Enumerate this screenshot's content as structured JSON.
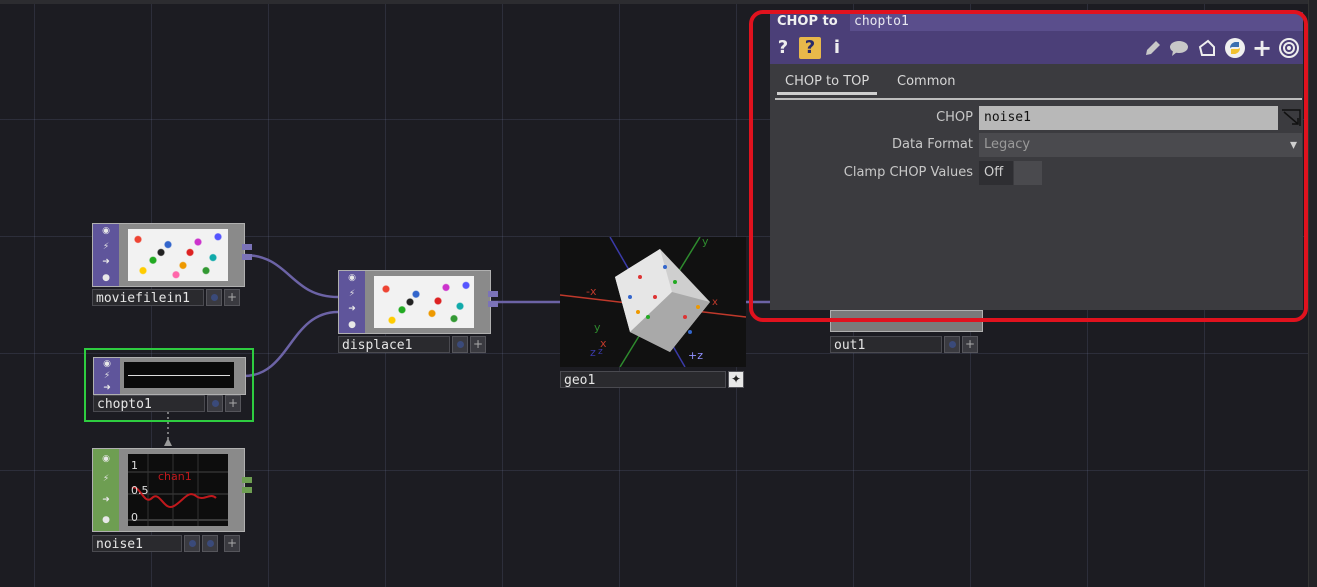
{
  "network": {
    "nodes": {
      "moviefilein1": {
        "name": "moviefilein1"
      },
      "displace1": {
        "name": "displace1"
      },
      "chopto1": {
        "name": "chopto1"
      },
      "noise1": {
        "name": "noise1",
        "graph_labels": [
          "1",
          "0.5",
          "0"
        ],
        "channel": "chan1"
      },
      "geo1": {
        "name": "geo1",
        "axis_labels": [
          "-x",
          "x",
          "y",
          "y",
          "z",
          "z",
          "+z",
          "x"
        ]
      },
      "out1": {
        "name": "out1"
      }
    }
  },
  "panel": {
    "op_type": "CHOP to",
    "op_name": "chopto1",
    "toolbar_icons": [
      "help-icon",
      "operator-help-icon",
      "info-icon",
      "edit-icon",
      "comment-icon",
      "clone-icon",
      "python-icon",
      "add-icon",
      "settings-icon"
    ],
    "toolbar_glyphs": {
      "help": "?",
      "op_help": "?",
      "info": "i",
      "add": "+"
    },
    "tabs": [
      {
        "label": "CHOP to TOP",
        "active": true
      },
      {
        "label": "Common",
        "active": false
      }
    ],
    "params": {
      "chop": {
        "label": "CHOP",
        "value": "noise1"
      },
      "data_format": {
        "label": "Data Format",
        "value": "Legacy"
      },
      "clamp": {
        "label": "Clamp CHOP Values",
        "value": "Off"
      }
    }
  },
  "colors": {
    "highlight": "#e0121e",
    "panel_header": "#4b3f78",
    "top_node": "#5f559b",
    "chop_node": "#6e9e52",
    "selected_outline": "#2ecc40"
  }
}
